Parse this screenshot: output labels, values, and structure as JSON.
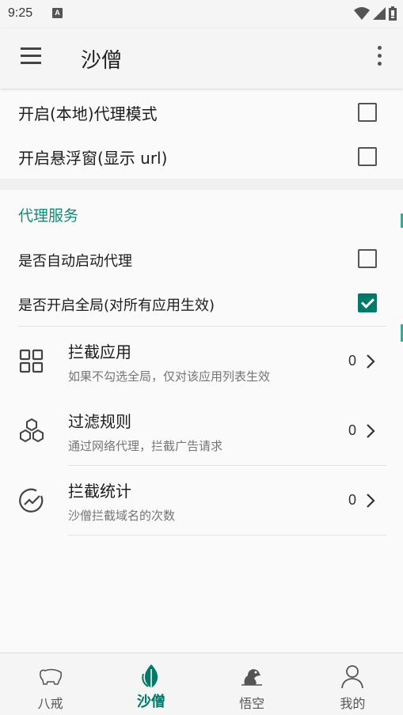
{
  "status_bar": {
    "time": "9:25",
    "notification_icon": "A"
  },
  "app_bar": {
    "title": "沙僧"
  },
  "top_settings": [
    {
      "label": "开启(本地)代理模式",
      "checked": false
    },
    {
      "label": "开启悬浮窗(显示 url)",
      "checked": false
    }
  ],
  "proxy_section": {
    "header": "代理服务",
    "toggles": [
      {
        "label": "是否自动启动代理",
        "checked": false
      },
      {
        "label": "是否开启全局(对所有应用生效)",
        "checked": true
      }
    ],
    "items": [
      {
        "icon": "grid-icon",
        "title": "拦截应用",
        "subtitle": "如果不勾选全局，仅对该应用列表生效",
        "count": "0"
      },
      {
        "icon": "hexagons-icon",
        "title": "过滤规则",
        "subtitle": "通过网络代理，拦截广告请求",
        "count": "0"
      },
      {
        "icon": "chart-circle-icon",
        "title": "拦截统计",
        "subtitle": "沙僧拦截域名的次数",
        "count": "0"
      }
    ]
  },
  "bottom_nav": [
    {
      "label": "八戒",
      "icon": "pig-icon",
      "active": false
    },
    {
      "label": "沙僧",
      "icon": "leaf-icon",
      "active": true
    },
    {
      "label": "悟空",
      "icon": "monkey-icon",
      "active": false
    },
    {
      "label": "我的",
      "icon": "person-icon",
      "active": false
    }
  ],
  "colors": {
    "accent": "#00796b",
    "section_header": "#138a76"
  }
}
